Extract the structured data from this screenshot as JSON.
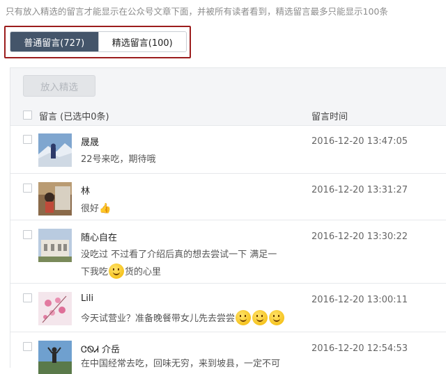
{
  "notice": "只有放入精选的留言才能显示在公众号文章下面，并被所有读者看到，精选留言最多只能显示100条",
  "tabs": [
    {
      "label": "普通留言(727)",
      "active": true
    },
    {
      "label": "精选留言(100)",
      "active": false
    }
  ],
  "toolbar": {
    "feature_button": "放入精选"
  },
  "table": {
    "comment_header": "留言 (已选中0条)",
    "time_header": "留言时间"
  },
  "comments": [
    {
      "user": "晟晟",
      "text": "22号来吃，期待哦",
      "time": "2016-12-20 13:47:05",
      "avatar": "snowy-mountain-photo"
    },
    {
      "user": "林",
      "text": "很好",
      "text_suffix_icon": "thumbs-up-icon",
      "time": "2016-12-20 13:31:27",
      "avatar": "indoor-photo"
    },
    {
      "user": "随心自在",
      "text_line1": "没吃过 不过看了介绍后真的想去尝试一下 满足一",
      "text_line2_a": "下我吃",
      "text_line2_b": "货的心里",
      "time": "2016-12-20 13:30:22",
      "avatar": "building-photo"
    },
    {
      "user": "Lili",
      "text": "今天试营业？准备晚餐带女儿先去尝尝",
      "time": "2016-12-20 13:00:11",
      "avatar": "pink-flower-photo"
    },
    {
      "user": "ᏣᏫᏗ 介岳",
      "text": "在中国经常去吃，回味无穷，来到坡县，一定不可",
      "time": "2016-12-20 12:54:53",
      "avatar": "outdoor-person-photo"
    }
  ]
}
